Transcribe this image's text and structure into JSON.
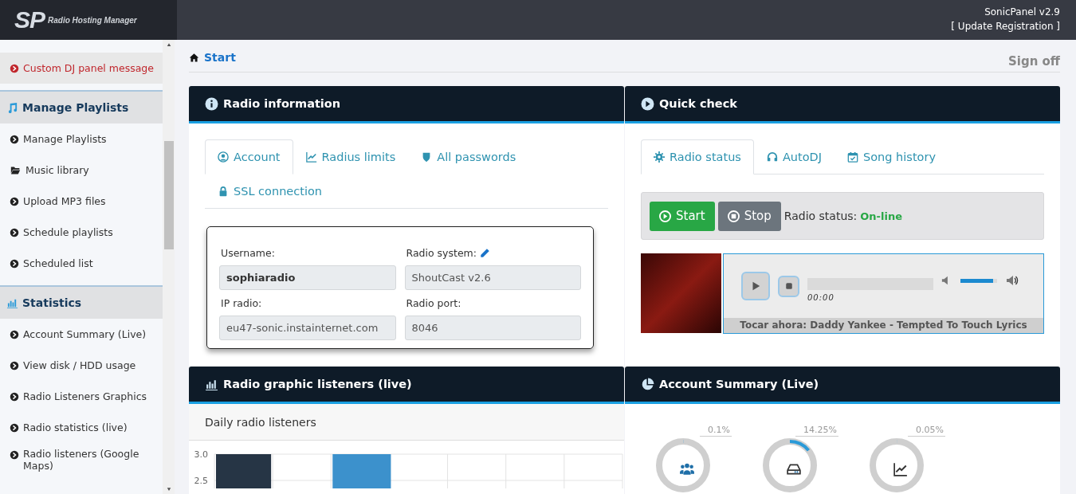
{
  "header": {
    "logo_mark": "SP",
    "logo_tagline": "Radio Hosting Manager",
    "version": "SonicPanel v2.9",
    "update_link": "[ Update Registration ]"
  },
  "sidebar": {
    "sections": [
      {
        "items": [
          {
            "label": "Custom DJ panel message",
            "kind": "alert",
            "selected": true
          }
        ]
      },
      {
        "title": "Manage Playlists",
        "items": [
          {
            "label": "Manage Playlists",
            "kind": "link",
            "selected": false
          },
          {
            "label": "Music library",
            "kind": "folder",
            "selected": false
          },
          {
            "label": "Upload MP3 files",
            "kind": "link",
            "selected": false
          },
          {
            "label": "Schedule playlists",
            "kind": "link",
            "selected": false
          },
          {
            "label": "Scheduled list",
            "kind": "link",
            "selected": false
          }
        ]
      },
      {
        "title": "Statistics",
        "items": [
          {
            "label": "Account Summary (Live)",
            "kind": "link",
            "selected": false
          },
          {
            "label": "View disk / HDD usage",
            "kind": "link",
            "selected": false
          },
          {
            "label": "Radio Listeners Graphics",
            "kind": "link",
            "selected": false
          },
          {
            "label": "Radio statistics (live)",
            "kind": "link",
            "selected": false
          },
          {
            "label": "Radio listeners (Google Maps)",
            "kind": "link",
            "selected": false
          }
        ]
      }
    ]
  },
  "breadcrumb": "Start",
  "sign_off": "Sign off",
  "radio_information": {
    "title": "Radio information",
    "tabs": [
      {
        "label": "Account",
        "selected": true
      },
      {
        "label": "Radius limits",
        "selected": false
      },
      {
        "label": "All passwords",
        "selected": false
      },
      {
        "label": "SSL connection",
        "selected": false
      }
    ],
    "fields": [
      {
        "label": "Username:",
        "value": "sophiaradio",
        "bold": true,
        "editable": false
      },
      {
        "label": "Radio system:",
        "value": "ShoutCast v2.6",
        "bold": false,
        "editable": true
      },
      {
        "label": "IP radio:",
        "value": "eu47-sonic.instainternet.com",
        "bold": false,
        "editable": false
      },
      {
        "label": "Radio port:",
        "value": "8046",
        "bold": false,
        "editable": false
      }
    ]
  },
  "quick_check": {
    "title": "Quick check",
    "tabs": [
      {
        "label": "Radio status",
        "selected": true
      },
      {
        "label": "AutoDJ",
        "selected": false
      },
      {
        "label": "Song history",
        "selected": false
      }
    ],
    "start_button": "Start",
    "stop_button": "Stop",
    "status_label": "Radio status:",
    "status_value": "On-line",
    "online": true,
    "player": {
      "time": "00:00",
      "progress": {
        "level": 0
      },
      "volume": {
        "level": 0.9
      },
      "now_playing": "Tocar ahora: Daddy Yankee - Tempted To Touch Lyrics"
    }
  },
  "listeners_graph": {
    "title": "Radio graphic listeners (live)",
    "subtitle": "Daily radio listeners",
    "chart_data": {
      "type": "bar",
      "stacked": true,
      "ylim": [
        0,
        3
      ],
      "yticks": [
        {
          "value": 3,
          "label": "3.0"
        },
        {
          "value": 2.5,
          "label": "2.5"
        }
      ],
      "series": [
        {
          "color": "#263545",
          "values": [
            3,
            null,
            null,
            null,
            null,
            null,
            null
          ]
        },
        {
          "color": "#3c91cc",
          "values": [
            null,
            null,
            3,
            null,
            null,
            null,
            null
          ]
        }
      ]
    }
  },
  "account_summary": {
    "title": "Account Summary (Live)",
    "gauges": [
      {
        "reading": "0.1%",
        "level": 0.001
      },
      {
        "reading": "14.25%",
        "level": 0.1425
      },
      {
        "reading": "0.05%",
        "level": 0.0005
      }
    ]
  }
}
